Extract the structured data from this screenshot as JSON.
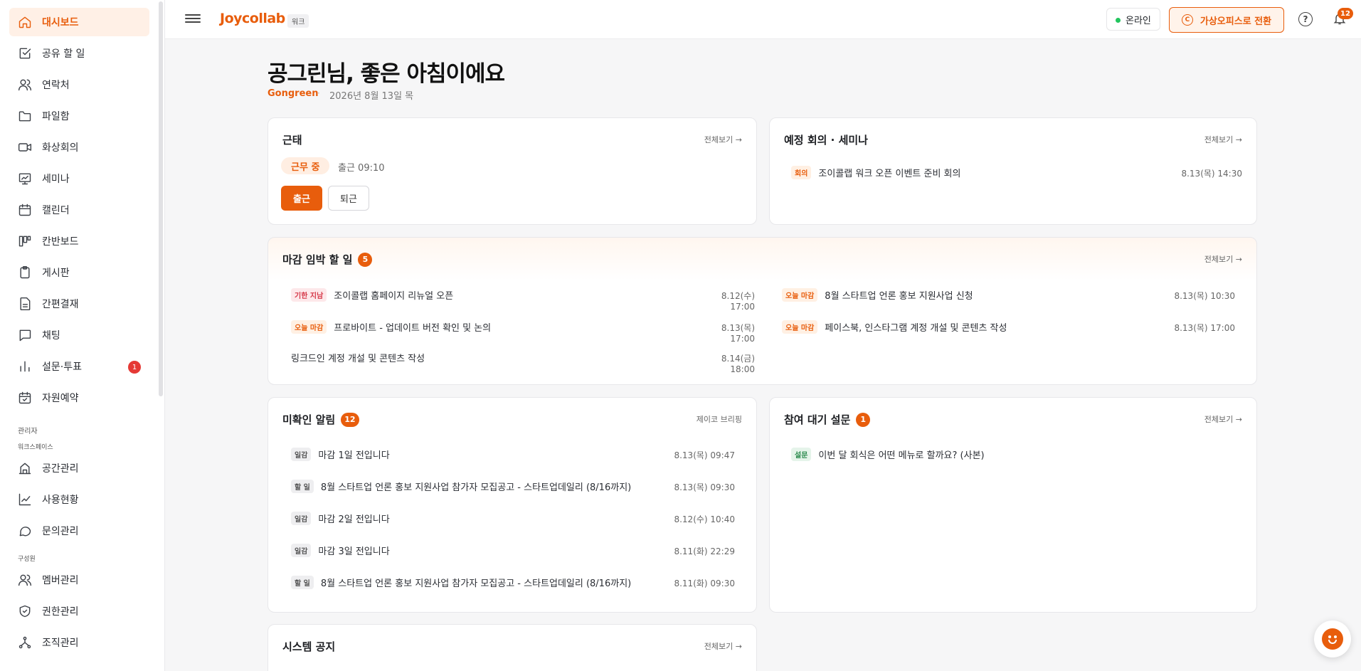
{
  "sidebar": {
    "items": [
      {
        "label": "대시보드",
        "icon": "home-icon",
        "active": true
      },
      {
        "label": "공유 할 일",
        "icon": "checkbox-icon"
      },
      {
        "label": "연락처",
        "icon": "users-icon"
      },
      {
        "label": "파일함",
        "icon": "folder-icon"
      },
      {
        "label": "화상회의",
        "icon": "video-icon"
      },
      {
        "label": "세미나",
        "icon": "presentation-icon"
      },
      {
        "label": "캘린더",
        "icon": "calendar-icon"
      },
      {
        "label": "칸반보드",
        "icon": "kanban-icon"
      },
      {
        "label": "게시판",
        "icon": "clipboard-icon"
      },
      {
        "label": "간편결재",
        "icon": "document-icon"
      },
      {
        "label": "채팅",
        "icon": "chat-icon"
      },
      {
        "label": "설문·투표",
        "icon": "bar-chart-icon",
        "badge": "1"
      },
      {
        "label": "자원예약",
        "icon": "calendar-check-icon"
      }
    ],
    "admin_label": "관리자",
    "workspace_label": "워크스페이스",
    "workspace_items": [
      {
        "label": "공간관리",
        "icon": "building-icon"
      },
      {
        "label": "사용현황",
        "icon": "line-chart-icon"
      },
      {
        "label": "문의관리",
        "icon": "message-icon"
      }
    ],
    "members_label": "구성원",
    "member_items": [
      {
        "label": "멤버관리",
        "icon": "users-icon"
      },
      {
        "label": "권한관리",
        "icon": "shield-icon"
      },
      {
        "label": "조직관리",
        "icon": "org-tree-icon"
      }
    ]
  },
  "topbar": {
    "logo": "Joycollab",
    "logo_tag": "워크",
    "status": "온라인",
    "virtual_office": "가상오피스로 전환",
    "help": "?",
    "notif_count": "12"
  },
  "header": {
    "greeting": "공그린님, 좋은 아침이에요",
    "user": "Gongreen",
    "sep": "·",
    "date": "2026년 8월 13일 목"
  },
  "attendance": {
    "title": "근태",
    "see_all": "전체보기 →",
    "status": "근무 중",
    "checkin": "출근 09:10",
    "btn_in": "출근",
    "btn_out": "퇴근"
  },
  "meetings": {
    "title": "예정 회의 · 세미나",
    "see_all": "전체보기 →",
    "items": [
      {
        "chip": "회의",
        "text": "조이콜랩 워크 오픈 이벤트 준비 회의",
        "date": "8.13(목) 14:30"
      }
    ]
  },
  "deadlines": {
    "title": "마감 임박 할 일",
    "count": "5",
    "see_all": "전체보기 →",
    "items": [
      {
        "chip": "기한 지남",
        "type": "overdue",
        "text": "조이콜랩 홈페이지 리뉴얼 오픈",
        "date": "8.12(수) 17:00"
      },
      {
        "chip": "오늘 마감",
        "type": "today",
        "text": "8월 스타트업 언론 홍보 지원사업 신청",
        "date": "8.13(목) 10:30"
      },
      {
        "chip": "오늘 마감",
        "type": "today",
        "text": "프로바이트 - 업데이트 버전 확인 및 논의",
        "date": "8.13(목) 17:00"
      },
      {
        "chip": "오늘 마감",
        "type": "today",
        "text": "페이스북, 인스타그램 계정 개설 및 콘텐츠 작성",
        "date": "8.13(목) 17:00"
      },
      {
        "chip": "",
        "type": "none",
        "text": "링크드인 계정 개설 및 콘텐츠 작성",
        "date": "8.14(금) 18:00"
      }
    ]
  },
  "notifications": {
    "title": "미확인 알림",
    "count": "12",
    "see_all": "제이코 브리핑",
    "items": [
      {
        "chip": "일감",
        "text": "마감 1일 전입니다",
        "date": "8.13(목) 09:47"
      },
      {
        "chip": "할 일",
        "text": "8월 스타트업 언론 홍보 지원사업 참가자 모집공고 - 스타트업데일리 (8/16까지)",
        "date": "8.13(목) 09:30"
      },
      {
        "chip": "일감",
        "text": "마감 2일 전입니다",
        "date": "8.12(수) 10:40"
      },
      {
        "chip": "일감",
        "text": "마감 3일 전입니다",
        "date": "8.11(화) 22:29"
      },
      {
        "chip": "할 일",
        "text": "8월 스타트업 언론 홍보 지원사업 참가자 모집공고 - 스타트업데일리 (8/16까지)",
        "date": "8.11(화) 09:30"
      }
    ]
  },
  "surveys": {
    "title": "참여 대기 설문",
    "count": "1",
    "see_all": "전체보기 →",
    "items": [
      {
        "chip": "설문",
        "text": "이번 달 회식은 어떤 메뉴로 할까요? (사본)"
      }
    ]
  },
  "notice": {
    "title": "시스템 공지",
    "see_all": "전체보기 →"
  },
  "colors": {
    "accent": "#e85d0c",
    "online": "#22c55e",
    "badge": "#e53935"
  }
}
